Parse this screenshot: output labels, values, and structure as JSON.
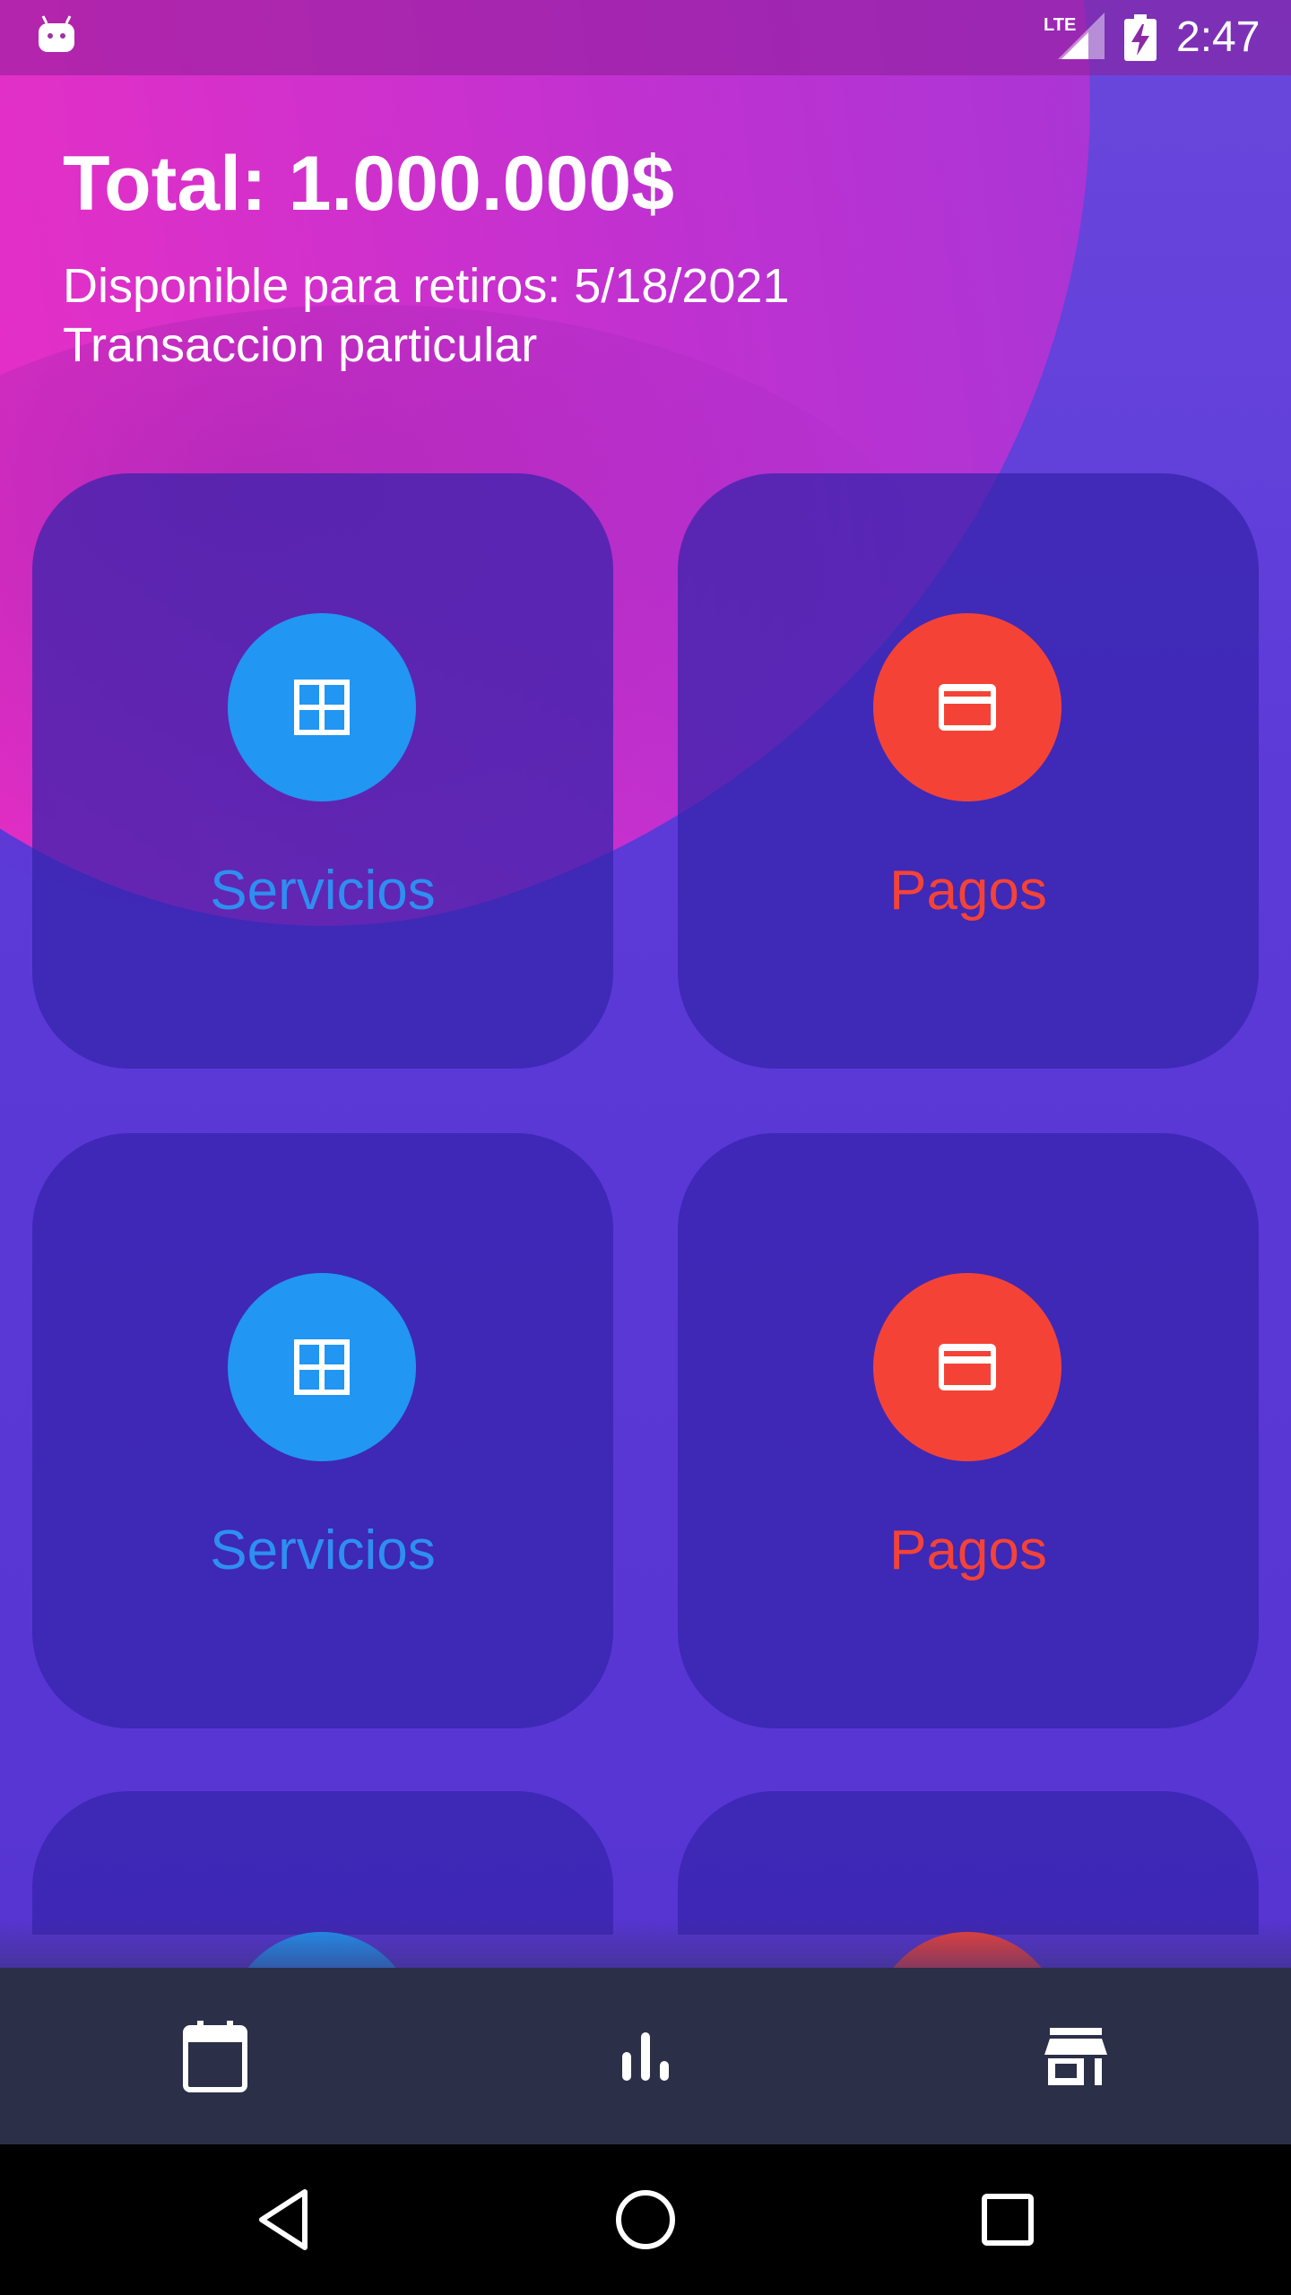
{
  "status_bar": {
    "network": "LTE",
    "time": "2:47",
    "icons": [
      "android-icon",
      "lte-signal-icon",
      "battery-charging-icon"
    ]
  },
  "header": {
    "total": "Total: 1.000.000$",
    "available": "Disponible para retiros: 5/18/2021",
    "transaction": "Transaccion particular"
  },
  "cards": [
    {
      "label": "Servicios",
      "icon": "grid-icon",
      "color": "#2196f3"
    },
    {
      "label": "Pagos",
      "icon": "credit-card-icon",
      "color": "#f44336"
    },
    {
      "label": "Servicios",
      "icon": "grid-icon",
      "color": "#2196f3"
    },
    {
      "label": "Pagos",
      "icon": "credit-card-icon",
      "color": "#f44336"
    }
  ],
  "bottom_nav": {
    "items": [
      "calendar-icon",
      "bar-chart-icon",
      "store-icon"
    ]
  },
  "system_nav": {
    "items": [
      "back-icon",
      "home-icon",
      "recents-icon"
    ]
  },
  "colors": {
    "background": "#5a3ad6",
    "blob": "#e22fc8",
    "card": "#3e2aae",
    "nav": "#2b2f48"
  }
}
